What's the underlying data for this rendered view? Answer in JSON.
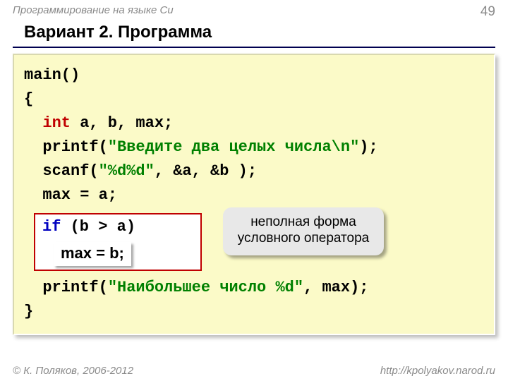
{
  "header": {
    "course": "Программирование на языке Си",
    "page": "49"
  },
  "title": "Вариант 2. Программа",
  "code": {
    "l1": "main()",
    "l2": "{",
    "l3a": "int",
    "l3b": " a, b, max;",
    "l4a": "printf(",
    "l4b": "\"Введите два целых числа\\n\"",
    "l4c": ");",
    "l5a": "scanf(",
    "l5b": "\"%d%d\"",
    "l5c": ", &a, &b );",
    "l6": "max = a;",
    "if_kw": "if",
    "if_cond": " (b > a)",
    "assign": "max = b;",
    "l8a": "printf(",
    "l8b": "\"Наибольшее число %d\"",
    "l8c": ", max);",
    "l9": "}"
  },
  "callout": "неполная форма условного оператора",
  "footer": {
    "left": "© К. Поляков, 2006-2012",
    "right": "http://kpolyakov.narod.ru"
  }
}
